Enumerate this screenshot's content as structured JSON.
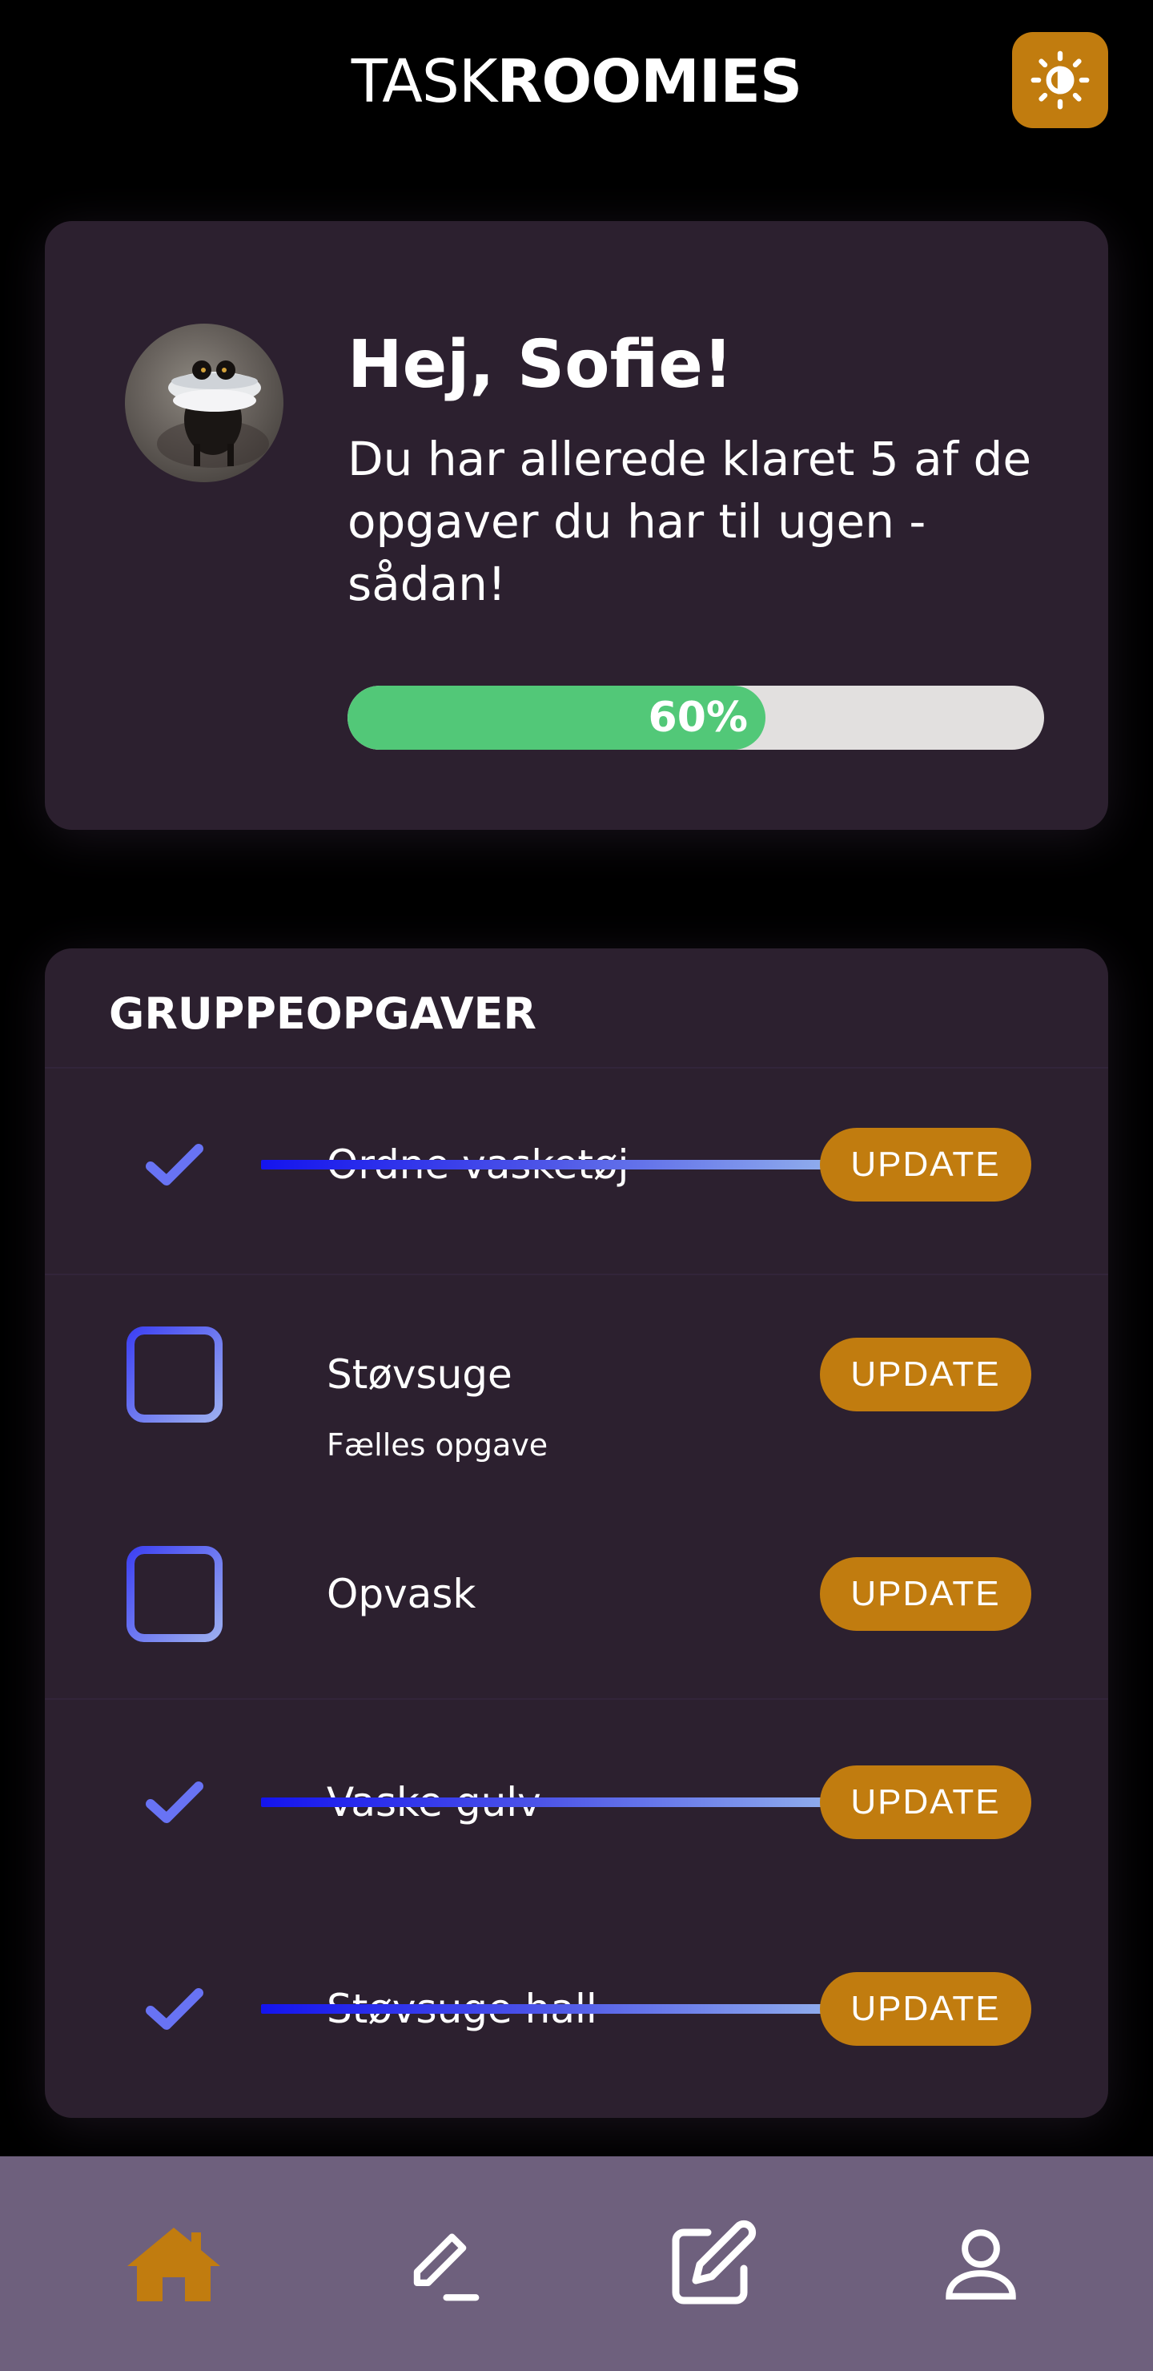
{
  "app": {
    "title_light": "TASK",
    "title_bold": "ROOMIES",
    "theme_toggle_icon": "sun-icon"
  },
  "greeting": {
    "title": "Hej, Sofie!",
    "message": "Du har allerede klaret 5 af de opgaver du har til ugen - sådan!",
    "progress_percent": 60,
    "progress_label": "60%"
  },
  "tasks": {
    "heading": "GRUPPEOPGAVER",
    "items": [
      {
        "label": "Ordne vasketøj",
        "done": true,
        "subtitle": "",
        "button": "UPDATE"
      },
      {
        "label": "Støvsuge",
        "done": false,
        "subtitle": "Fælles opgave",
        "button": "UPDATE"
      },
      {
        "label": "Opvask",
        "done": false,
        "subtitle": "",
        "button": "UPDATE"
      },
      {
        "label": "Vaske gulv",
        "done": true,
        "subtitle": "",
        "button": "UPDATE"
      },
      {
        "label": "Støvsuge hall",
        "done": true,
        "subtitle": "",
        "button": "UPDATE"
      }
    ]
  },
  "nav": {
    "items": [
      {
        "icon": "home-icon",
        "active": true
      },
      {
        "icon": "pencil-icon",
        "active": false
      },
      {
        "icon": "edit-square-icon",
        "active": false
      },
      {
        "icon": "user-icon",
        "active": false
      }
    ]
  },
  "colors": {
    "accent": "#c17c0f",
    "progress": "#52c878",
    "card": "#2c202f",
    "nav": "#6e607d",
    "checkbox": "#5b5ff0"
  }
}
